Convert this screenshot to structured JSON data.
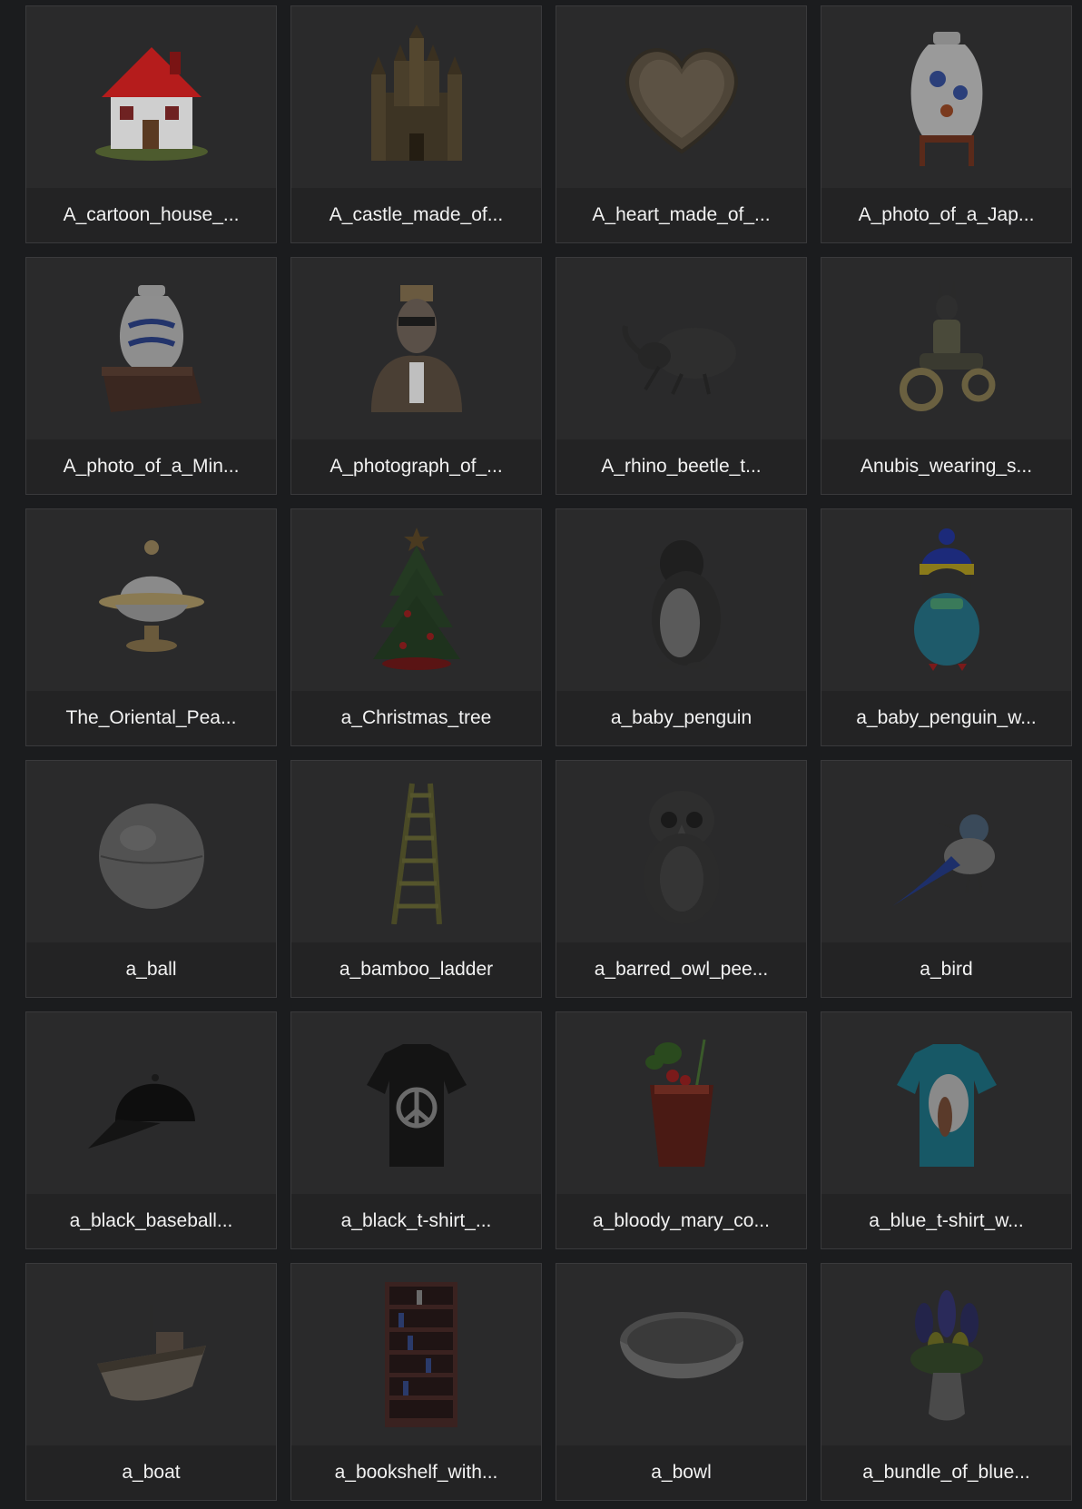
{
  "gallery": {
    "items": [
      {
        "label": "A_cartoon_house_...",
        "icon": "house-icon"
      },
      {
        "label": "A_castle_made_of...",
        "icon": "castle-icon"
      },
      {
        "label": "A_heart_made_of_...",
        "icon": "heart-icon"
      },
      {
        "label": "A_photo_of_a_Jap...",
        "icon": "vase-icon"
      },
      {
        "label": "A_photo_of_a_Min...",
        "icon": "ming-vase-icon"
      },
      {
        "label": "A_photograph_of_...",
        "icon": "bust-icon"
      },
      {
        "label": "A_rhino_beetle_t...",
        "icon": "beetle-icon"
      },
      {
        "label": "Anubis_wearing_s...",
        "icon": "motorcycle-rider-icon"
      },
      {
        "label": "The_Oriental_Pea...",
        "icon": "dome-icon"
      },
      {
        "label": "a_Christmas_tree",
        "icon": "christmas-tree-icon"
      },
      {
        "label": "a_baby_penguin",
        "icon": "penguin-icon"
      },
      {
        "label": "a_baby_penguin_w...",
        "icon": "penguin-hat-icon"
      },
      {
        "label": "a_ball",
        "icon": "ball-icon"
      },
      {
        "label": "a_bamboo_ladder",
        "icon": "ladder-icon"
      },
      {
        "label": "a_barred_owl_pee...",
        "icon": "owl-icon"
      },
      {
        "label": "a_bird",
        "icon": "bird-icon"
      },
      {
        "label": "a_black_baseball...",
        "icon": "cap-icon"
      },
      {
        "label": "a_black_t-shirt_...",
        "icon": "black-tshirt-icon"
      },
      {
        "label": "a_bloody_mary_co...",
        "icon": "cocktail-icon"
      },
      {
        "label": "a_blue_t-shirt_w...",
        "icon": "blue-tshirt-icon"
      },
      {
        "label": "a_boat",
        "icon": "boat-icon"
      },
      {
        "label": "a_bookshelf_with...",
        "icon": "bookshelf-icon"
      },
      {
        "label": "a_bowl",
        "icon": "bowl-icon"
      },
      {
        "label": "a_bundle_of_blue...",
        "icon": "flowers-icon"
      }
    ]
  }
}
